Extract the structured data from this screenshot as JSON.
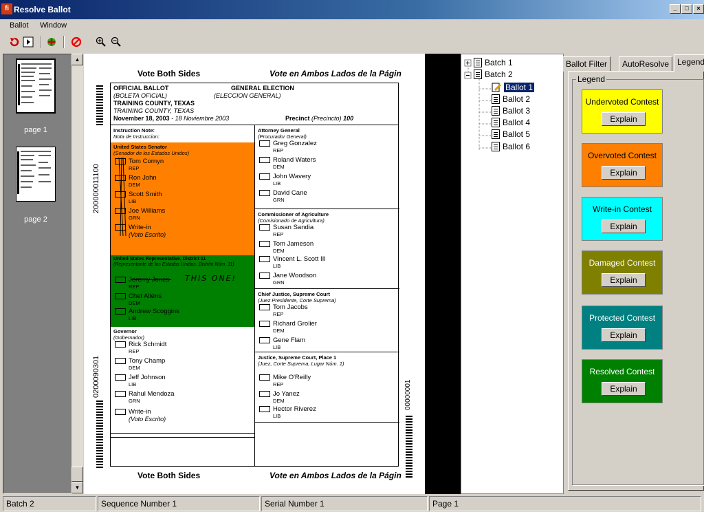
{
  "window": {
    "title": "Resolve Ballot",
    "app_icon": "app-logo-icon",
    "controls": [
      "_",
      "□",
      "×"
    ]
  },
  "menu": [
    {
      "label": "Ballot"
    },
    {
      "label": "Window"
    }
  ],
  "toolbar": {
    "icons": [
      "undo-icon",
      "next-icon",
      "resolve-icon",
      "cancel-icon",
      "zoom-in-icon",
      "zoom-out-icon"
    ]
  },
  "thumbnails": [
    {
      "label": "page 1"
    },
    {
      "label": "page 2"
    }
  ],
  "ballot": {
    "top_left": "Vote Both Sides",
    "top_right": "Vote en Ambos Lados de la Págin",
    "bottom_left": "Vote Both Sides",
    "bottom_right": "Vote en Ambos Lados de la Págin",
    "header": {
      "official": "OFFICIAL BALLOT",
      "official_es": "(BOLETA OFICIAL)",
      "election": "GENERAL ELECTION",
      "election_es": "(ELECCION GENERAL)",
      "county": "TRAINING COUNTY, TEXAS",
      "county_es": "TRAINING COUNTY, TEXAS",
      "date": "November 18, 2003",
      "date_es": "- 18 Noviembre 2003",
      "precinct_label": "Precinct",
      "precinct_es": "(Precincto)",
      "precinct_no": "100"
    },
    "side_numbers": {
      "left_top": "200000011100",
      "left_bottom": "0200090301",
      "right_bottom": "00000001"
    },
    "instruction": {
      "title": "Instruction Note:",
      "subtitle": "Nota de Instruccion:"
    },
    "left_contests": [
      {
        "title": "United States Senator",
        "subtitle": "(Senador de los Estados Unidos)",
        "candidates": [
          {
            "name": "Tom Cornyn",
            "party": "REP"
          },
          {
            "name": "Ron John",
            "party": "DEM"
          },
          {
            "name": "Scott Smith",
            "party": "LIB"
          },
          {
            "name": "Joe Williams",
            "party": "GRN"
          },
          {
            "name": "Write-in",
            "party": "(Voto Escrito)"
          }
        ]
      },
      {
        "title": "United States Representative, District 11",
        "subtitle": "(Representante de los Estados Unidos, Distrito Núm. 11)",
        "candidates": [
          {
            "name": "Jeremy Jones",
            "party": "REP"
          },
          {
            "name": "Chet Allens",
            "party": "DEM"
          },
          {
            "name": "Andrew Scoggins",
            "party": "LIB"
          }
        ],
        "handwriting": "THIS ONE!"
      },
      {
        "title": "Governor",
        "subtitle": "(Gobernador)",
        "candidates": [
          {
            "name": "Rick Schmidt",
            "party": "REP"
          },
          {
            "name": "Tony Champ",
            "party": "DEM"
          },
          {
            "name": "Jeff Johnson",
            "party": "LIB"
          },
          {
            "name": "Rahul Mendoza",
            "party": "GRN"
          },
          {
            "name": "Write-in",
            "party": "(Voto Escrito)"
          }
        ]
      }
    ],
    "right_contests": [
      {
        "title": "Attorney General",
        "subtitle": "(Procurador General)",
        "candidates": [
          {
            "name": "Greg Gonzalez",
            "party": "REP"
          },
          {
            "name": "Roland Waters",
            "party": "DEM"
          },
          {
            "name": "John Wavery",
            "party": "LIB"
          },
          {
            "name": "David Cane",
            "party": "GRN"
          }
        ]
      },
      {
        "title": "Commissioner of Agriculture",
        "subtitle": "(Comisionado de Agricultura)",
        "candidates": [
          {
            "name": "Susan Sandia",
            "party": "REP"
          },
          {
            "name": "Tom Jameson",
            "party": "DEM"
          },
          {
            "name": "Vincent L. Scott III",
            "party": "LIB"
          },
          {
            "name": "Jane Woodson",
            "party": "GRN"
          }
        ]
      },
      {
        "title": "Chief Justice, Supreme Court",
        "subtitle": "(Juez Presidente, Corte Suprema)",
        "candidates": [
          {
            "name": "Tom Jacobs",
            "party": "REP"
          },
          {
            "name": "Richard Grolier",
            "party": "DEM"
          },
          {
            "name": "Gene Flam",
            "party": "LIB"
          }
        ]
      },
      {
        "title": "Justice, Supreme Court, Place 1",
        "subtitle": "(Juez, Corte Suprema, Lugar Núm. 1)",
        "candidates": [
          {
            "name": "Mike O'Reilly",
            "party": "REP"
          },
          {
            "name": "Jo Yanez",
            "party": "DEM"
          },
          {
            "name": "Hector Riverez",
            "party": "LIB"
          }
        ]
      }
    ],
    "highlight_colors": {
      "overvoted": "#ff8000",
      "protected": "#008000"
    }
  },
  "tree": {
    "batches": [
      {
        "label": "Batch 1"
      },
      {
        "label": "Batch 2"
      }
    ],
    "ballots": [
      {
        "label": "Ballot 1",
        "selected": true
      },
      {
        "label": "Ballot 2"
      },
      {
        "label": "Ballot 3"
      },
      {
        "label": "Ballot 4"
      },
      {
        "label": "Ballot 5"
      },
      {
        "label": "Ballot 6"
      }
    ]
  },
  "tabs": [
    {
      "label": "Ballot Filter"
    },
    {
      "label": "AutoResolve"
    },
    {
      "label": "Legend",
      "active": true
    }
  ],
  "legend": {
    "title": "Legend",
    "explain_label": "Explain",
    "items": [
      {
        "label": "Undervoted Contest",
        "color": "#ffff00",
        "text_color": "#000000"
      },
      {
        "label": "Overvoted Contest",
        "color": "#ff8000",
        "text_color": "#000000"
      },
      {
        "label": "Write-in Contest",
        "color": "#00ffff",
        "text_color": "#000000"
      },
      {
        "label": "Damaged Contest",
        "color": "#808000",
        "text_color": "#ffffff"
      },
      {
        "label": "Protected Contest",
        "color": "#008080",
        "text_color": "#ffffff"
      },
      {
        "label": "Resolved Contest",
        "color": "#008000",
        "text_color": "#ffffff"
      }
    ]
  },
  "status": {
    "batch": "Batch 2",
    "sequence": "Sequence Number 1",
    "serial": "Serial Number 1",
    "page": "Page 1"
  }
}
